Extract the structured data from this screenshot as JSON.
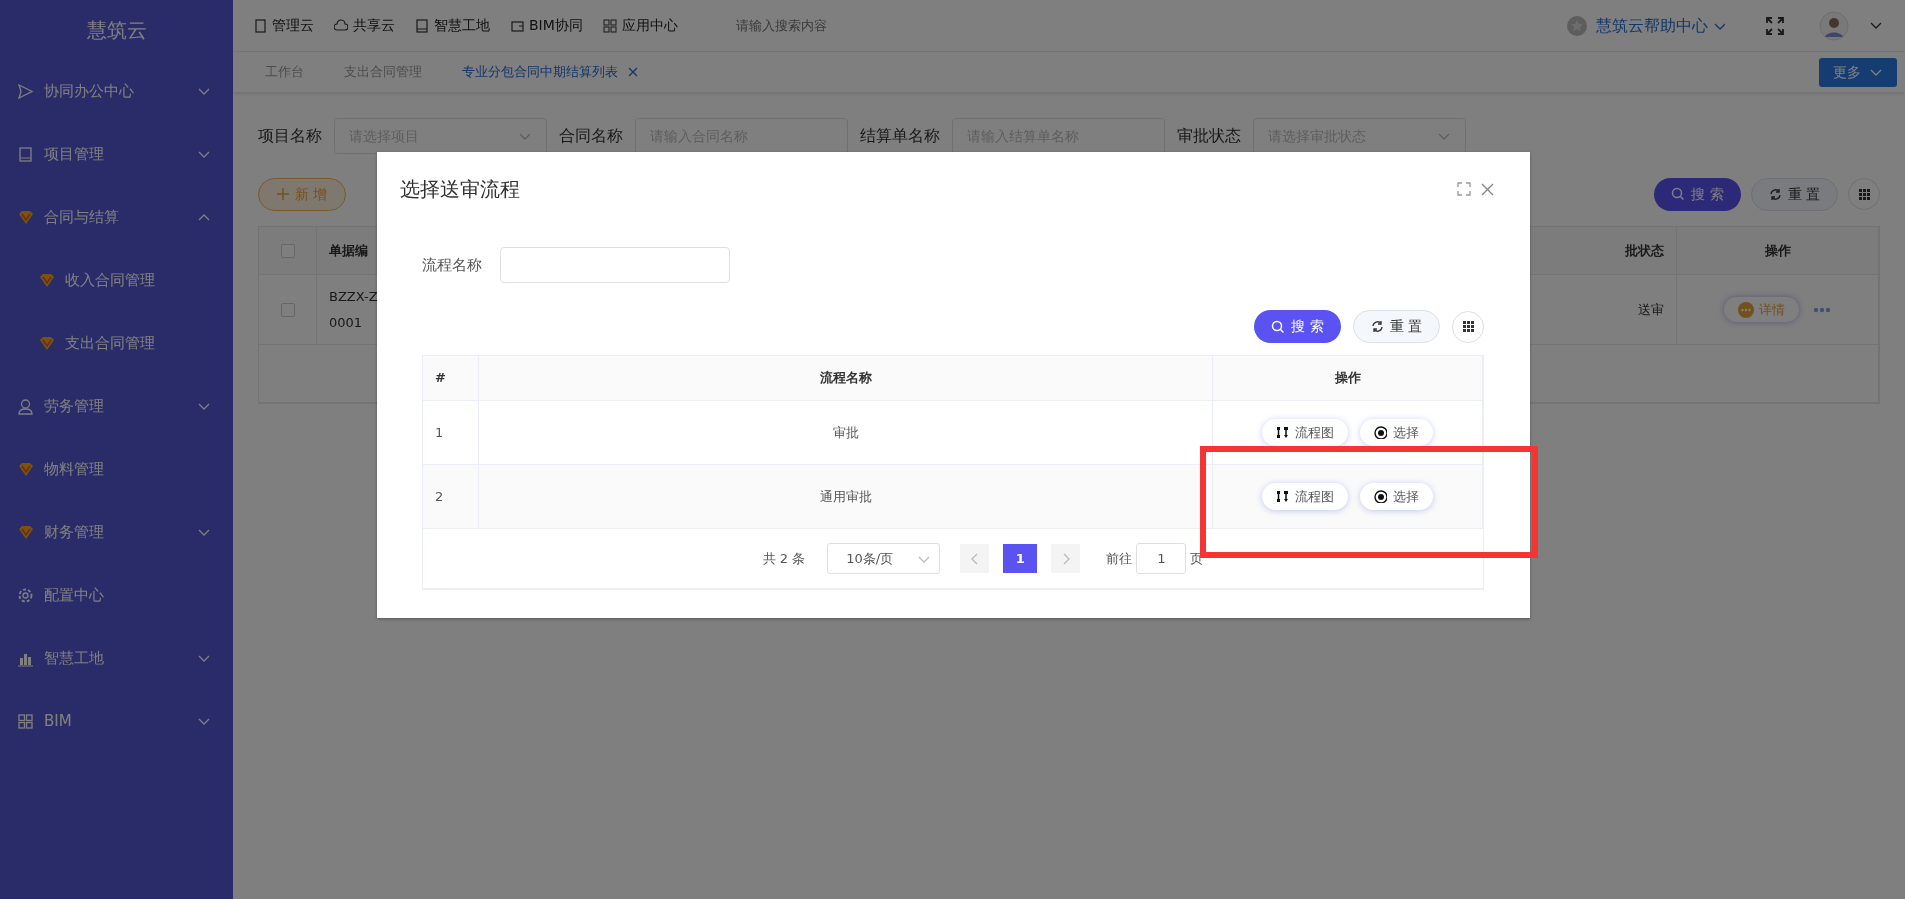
{
  "sidebar": {
    "logo": "慧筑云",
    "items": [
      {
        "label": "协同办公中心",
        "kind": "group",
        "expanded": false
      },
      {
        "label": "项目管理",
        "kind": "group",
        "expanded": false
      },
      {
        "label": "合同与结算",
        "kind": "group",
        "expanded": true,
        "children": [
          {
            "label": "收入合同管理"
          },
          {
            "label": "支出合同管理"
          }
        ]
      },
      {
        "label": "劳务管理",
        "kind": "group",
        "expanded": false
      },
      {
        "label": "物料管理",
        "kind": "link"
      },
      {
        "label": "财务管理",
        "kind": "group",
        "expanded": false
      },
      {
        "label": "配置中心",
        "kind": "link"
      },
      {
        "label": "智慧工地",
        "kind": "group",
        "expanded": false
      },
      {
        "label": "BIM",
        "kind": "group",
        "expanded": false
      }
    ]
  },
  "top_nav": [
    "管理云",
    "共享云",
    "智慧工地",
    "BIM协同",
    "应用中心"
  ],
  "search": {
    "placeholder": "请输入搜索内容"
  },
  "help_center": "慧筑云帮助中心",
  "tabs": [
    {
      "label": "工作台",
      "selected": false,
      "closable": false
    },
    {
      "label": "支出合同管理",
      "selected": false,
      "closable": false
    },
    {
      "label": "专业分包合同中期结算列表",
      "selected": true,
      "closable": true
    }
  ],
  "more_button": "更多",
  "filters": [
    {
      "label": "项目名称",
      "placeholder": "请选择项目",
      "kind": "select"
    },
    {
      "label": "合同名称",
      "placeholder": "请输入合同名称",
      "kind": "input"
    },
    {
      "label": "结算单名称",
      "placeholder": "请输入结算单名称",
      "kind": "input"
    },
    {
      "label": "审批状态",
      "placeholder": "请选择审批状态",
      "kind": "select"
    }
  ],
  "add_button": "新 增",
  "search_button": "搜 索",
  "reset_button": "重 置",
  "list_table": {
    "header_checked": false,
    "column_left": "单据编",
    "columns_right": [
      "批状态",
      "操作"
    ],
    "rows": [
      {
        "checked": false,
        "code_lines": [
          "BZZX-Z",
          "0001"
        ],
        "status": "送审",
        "action": "详情"
      }
    ]
  },
  "modal": {
    "title": "选择送审流程",
    "field_label": "流程名称",
    "search_button": "搜 索",
    "reset_button": "重 置",
    "columns": [
      "#",
      "流程名称",
      "操作"
    ],
    "rows": [
      {
        "index": "1",
        "name": "审批",
        "actions": [
          "流程图",
          "选择"
        ]
      },
      {
        "index": "2",
        "name": "通用审批",
        "actions": [
          "流程图",
          "选择"
        ]
      }
    ],
    "pagination": {
      "total": "共 2 条",
      "page_size": "10条/页",
      "pages": [
        {
          "label": "1",
          "selected": true
        }
      ],
      "goto_label": "前往",
      "goto_value": "1",
      "goto_suffix": "页"
    }
  }
}
